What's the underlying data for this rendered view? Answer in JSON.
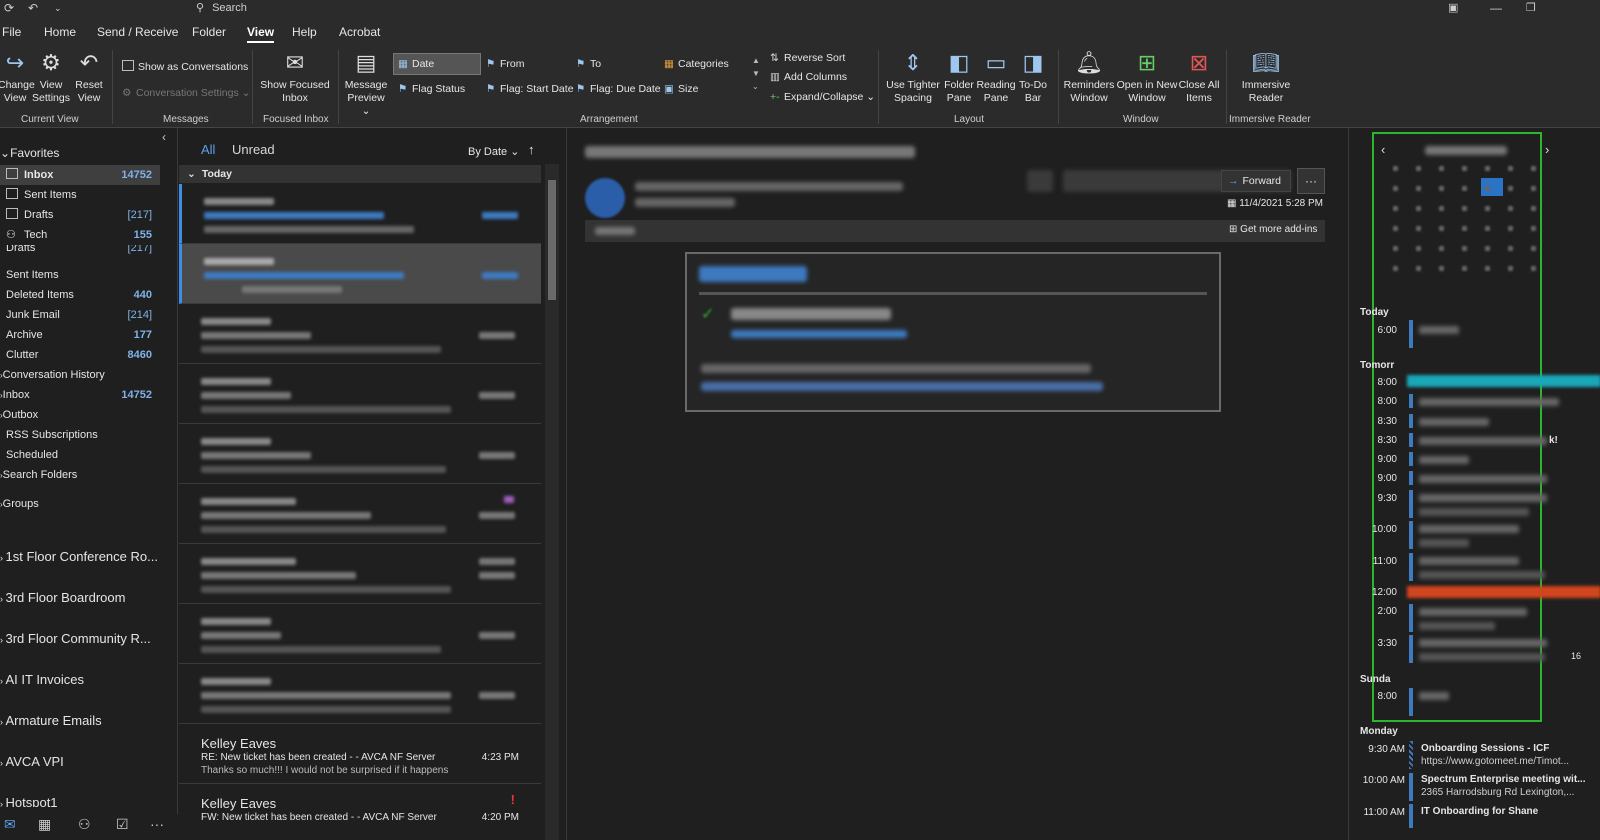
{
  "titlebar": {
    "search_placeholder": "Search"
  },
  "menu": {
    "tabs": [
      "File",
      "Home",
      "Send / Receive",
      "Folder",
      "View",
      "Help",
      "Acrobat"
    ],
    "active": "View"
  },
  "ribbon": {
    "current_view": {
      "change_view": "Change View",
      "view_settings": "View Settings",
      "reset_view": "Reset View",
      "label": "Current View"
    },
    "messages": {
      "show_conversations": "Show as Conversations",
      "conversation_settings": "Conversation Settings",
      "label": "Messages"
    },
    "focused_inbox": {
      "show_focused": "Show Focused Inbox",
      "label": "Focused Inbox"
    },
    "arrangement": {
      "message_preview": "Message Preview",
      "date": "Date",
      "from": "From",
      "to": "To",
      "categories": "Categories",
      "flag_status": "Flag Status",
      "flag_start": "Flag: Start Date",
      "flag_due": "Flag: Due Date",
      "size": "Size",
      "reverse_sort": "Reverse Sort",
      "add_columns": "Add Columns",
      "expand_collapse": "Expand/Collapse",
      "label": "Arrangement"
    },
    "layout": {
      "tighter_spacing": "Use Tighter Spacing",
      "folder_pane": "Folder Pane",
      "reading_pane": "Reading Pane",
      "todo_bar": "To-Do Bar",
      "label": "Layout"
    },
    "window": {
      "reminders": "Reminders Window",
      "open_new": "Open in New Window",
      "close_all": "Close All Items",
      "label": "Window"
    },
    "immersive": {
      "reader": "Immersive Reader",
      "label": "Immersive Reader"
    }
  },
  "folders": {
    "favorites_label": "Favorites",
    "favorites": [
      {
        "name": "Inbox",
        "count": "14752"
      },
      {
        "name": "Sent Items",
        "count": ""
      },
      {
        "name": "Drafts",
        "count": "[217]"
      },
      {
        "name": "Tech",
        "count": "155"
      }
    ],
    "drafts_partial": "Drafts",
    "drafts_partial_count": "[217]",
    "mailbox": [
      {
        "name": "Sent Items",
        "count": ""
      },
      {
        "name": "Deleted Items",
        "count": "440"
      },
      {
        "name": "Junk Email",
        "count": "[214]"
      },
      {
        "name": "Archive",
        "count": "177"
      },
      {
        "name": "Clutter",
        "count": "8460"
      },
      {
        "name": "Conversation History",
        "count": ""
      },
      {
        "name": "Inbox",
        "count": "14752"
      },
      {
        "name": "Outbox",
        "count": ""
      },
      {
        "name": "RSS Subscriptions",
        "count": ""
      },
      {
        "name": "Scheduled",
        "count": ""
      },
      {
        "name": "Search Folders",
        "count": ""
      }
    ],
    "groups_label": "Groups",
    "shared": [
      "1st Floor Conference Ro...",
      "3rd Floor Boardroom",
      "3rd Floor Community R...",
      "AI IT Invoices",
      "Armature Emails",
      "AVCA VPI",
      "Hotspot1"
    ]
  },
  "message_list": {
    "tab_all": "All",
    "tab_unread": "Unread",
    "sort_label": "By Date",
    "group_today": "Today",
    "visible_messages": [
      {
        "sender": "Kelley Eaves",
        "subject": "RE: New ticket has been created -  - AVCA NF Server",
        "preview": "Thanks so much!!!  I would not be surprised if it happens",
        "time": "4:23 PM"
      },
      {
        "sender": "Kelley Eaves",
        "subject": "FW: New ticket has been created -  - AVCA NF Server",
        "preview": "",
        "time": "4:20 PM",
        "flag": "!"
      }
    ]
  },
  "reading_pane": {
    "forward_label": "Forward",
    "more_label": "···",
    "timestamp": "11/4/2021 5:28 PM",
    "get_addins": "Get more add-ins"
  },
  "todo_bar": {
    "day_today": "Today",
    "day_tomorrow": "Tomorr",
    "day_sunday": "Sunda",
    "day_monday": "Monday",
    "times": [
      "6:00",
      "8:00",
      "8:00",
      "8:30",
      "8:30",
      "9:00",
      "9:00",
      "9:30",
      "10:00",
      "11:00",
      "12:00",
      "2:00",
      "3:30",
      "8:00"
    ],
    "monday_events": [
      {
        "time": "9:30 AM",
        "title": "Onboarding Sessions - ICF",
        "sub": "https://www.gotomeet.me/Timot..."
      },
      {
        "time": "10:00 AM",
        "title": "Spectrum Enterprise meeting wit...",
        "sub": "2365 Harrodsburg Rd Lexington,..."
      },
      {
        "time": "11:00 AM",
        "title": "IT Onboarding for Shane",
        "sub": ""
      }
    ],
    "partial_right_labels": [
      "k!",
      "16"
    ],
    "colors": {
      "highlight_border": "#2db52d",
      "event_teal": "#1aa7b8",
      "event_orange": "#d2461f",
      "event_blue": "#3d7ac0"
    }
  },
  "colors": {
    "accent": "#3d8ee6",
    "background": "#1f1f1f",
    "ribbon": "#2b2b2b"
  }
}
